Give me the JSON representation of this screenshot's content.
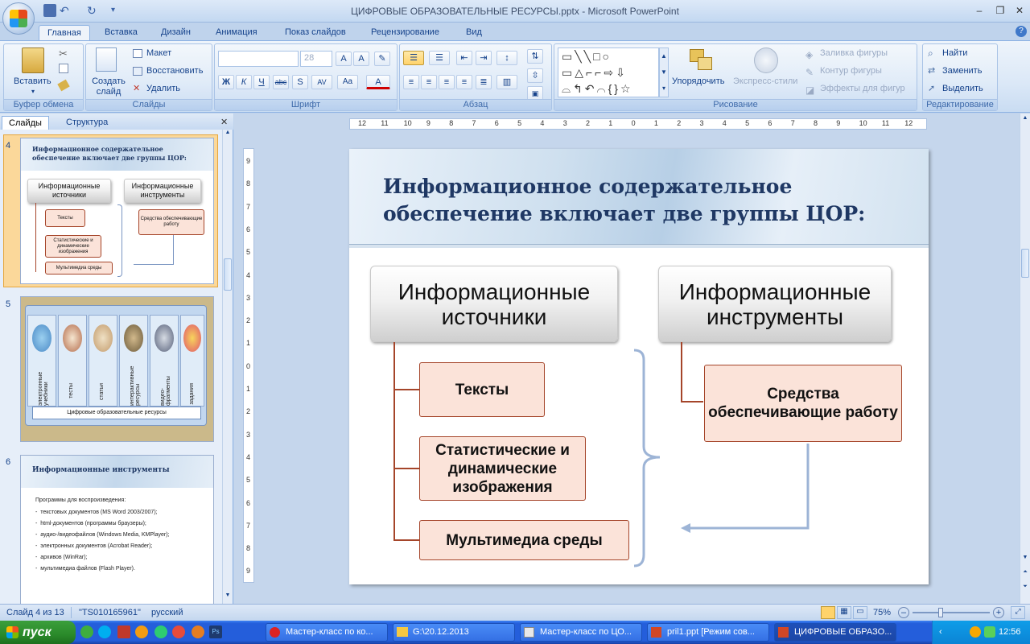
{
  "window": {
    "title": "ЦИФРОВЫЕ ОБРАЗОВАТЕЛЬНЫЕ РЕСУРСЫ.pptx - Microsoft PowerPoint"
  },
  "tabs": [
    "Главная",
    "Вставка",
    "Дизайн",
    "Анимация",
    "Показ слайдов",
    "Рецензирование",
    "Вид"
  ],
  "ribbon": {
    "clipboard": {
      "label": "Буфер обмена",
      "paste": "Вставить"
    },
    "slides": {
      "label": "Слайды",
      "new_slide": "Создать слайд",
      "layout": "Макет",
      "reset": "Восстановить",
      "delete": "Удалить"
    },
    "font": {
      "label": "Шрифт",
      "size": "28"
    },
    "paragraph": {
      "label": "Абзац"
    },
    "drawing": {
      "label": "Рисование",
      "arrange": "Упорядочить",
      "quick_styles": "Экспресс-стили",
      "shape_fill": "Заливка фигуры",
      "shape_outline": "Контур фигуры",
      "shape_effects": "Эффекты для фигур"
    },
    "editing": {
      "label": "Редактирование",
      "find": "Найти",
      "replace": "Заменить",
      "select": "Выделить"
    }
  },
  "panel": {
    "tab_slides": "Слайды",
    "tab_outline": "Структура"
  },
  "thumbnails": [
    {
      "num": "4",
      "title": "Информационное содержательное обеспечение включает две группы ЦОР:",
      "h1": "Информационные источники",
      "h2": "Информационные инструменты",
      "s1": "Тексты",
      "s2": "Статистические и динамические изображения",
      "s3": "Мультимедиа среды",
      "s4": "Средства обеспечивающие работу"
    },
    {
      "num": "5",
      "columns": [
        "электронные учебники",
        "тесты",
        "статьи",
        "интерактивные ресурсы",
        "видео-фрагменты",
        "задания"
      ],
      "arrow_label": "Цифровые образовательные ресурсы"
    },
    {
      "num": "6",
      "title": "Информационные инструменты",
      "intro": "Программы для воспроизведения:",
      "items": [
        "текстовых документов (MS Word 2003/2007);",
        "html-документов (программы браузеры);",
        "аудио-/видеофайлов (Windows Media, KMPlayer);",
        "электронных документов (Acrobat Reader);",
        "архивов (WinRar);",
        "мультимедиа файлов (Flash Player)."
      ]
    }
  ],
  "ruler": {
    "labels": [
      "12",
      "11",
      "10",
      "9",
      "8",
      "7",
      "6",
      "5",
      "4",
      "3",
      "2",
      "1",
      "0",
      "1",
      "2",
      "3",
      "4",
      "5",
      "6",
      "7",
      "8",
      "9",
      "10",
      "11",
      "12"
    ],
    "vlabels": [
      "9",
      "8",
      "7",
      "6",
      "5",
      "4",
      "3",
      "2",
      "1",
      "0",
      "1",
      "2",
      "3",
      "4",
      "5",
      "6",
      "7",
      "8",
      "9"
    ]
  },
  "slide": {
    "title": "Информационное содержательное обеспечение включает две группы ЦОР:",
    "left_header": "Информационные источники",
    "right_header": "Информационные инструменты",
    "left_items": [
      "Тексты",
      "Статистические и динамические изображения",
      "Мультимедиа среды"
    ],
    "right_item": "Средства обеспечивающие работу"
  },
  "status": {
    "slide_counter": "Слайд 4 из 13",
    "theme": "\"TS010165961\"",
    "language": "русский",
    "zoom": "75%"
  },
  "taskbar": {
    "start": "пуск",
    "tasks": [
      "Мастер-класс по ко...",
      "G:\\20.12.2013",
      "Мастер-класс по ЦО...",
      "pril1.ppt [Режим сов...",
      "ЦИФРОВЫЕ ОБРАЗО..."
    ],
    "clock": "12:56"
  }
}
